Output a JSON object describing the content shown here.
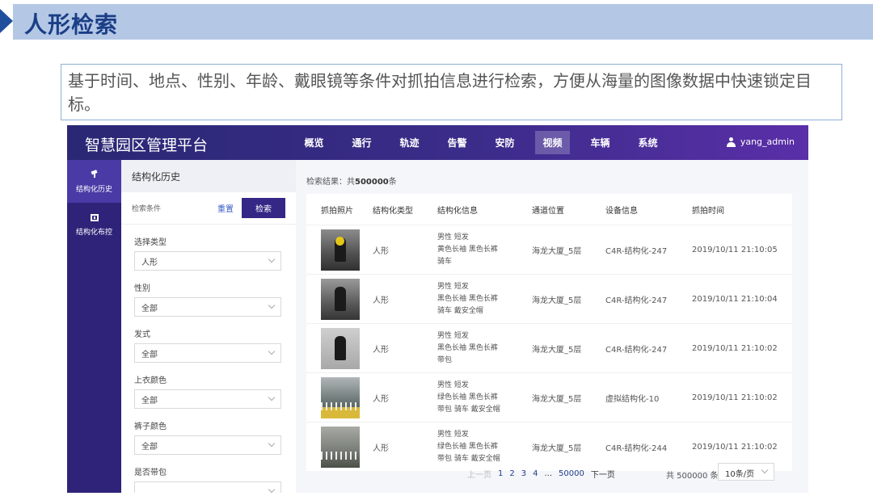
{
  "slide": {
    "title": "人形检索",
    "description": "基于时间、地点、性别、年龄、戴眼镜等条件对抓拍信息进行检索，方便从海量的图像数据中快速锁定目标。"
  },
  "app": {
    "title": "智慧园区管理平台",
    "nav": [
      "概览",
      "通行",
      "轨迹",
      "告警",
      "安防",
      "视频",
      "车辆",
      "系统"
    ],
    "active_nav": "视频",
    "user": "yang_admin"
  },
  "sidebar": {
    "items": [
      {
        "label": "结构化历史",
        "icon": "camera-icon"
      },
      {
        "label": "结构化布控",
        "icon": "calendar-icon"
      }
    ]
  },
  "filter": {
    "title": "结构化历史",
    "conditions_label": "检索条件",
    "reset": "重置",
    "search": "检索",
    "fields": [
      {
        "label": "选择类型",
        "value": "人形"
      },
      {
        "label": "性别",
        "value": "全部"
      },
      {
        "label": "发式",
        "value": "全部"
      },
      {
        "label": "上衣颜色",
        "value": "全部"
      },
      {
        "label": "裤子颜色",
        "value": "全部"
      },
      {
        "label": "是否带包",
        "value": ""
      }
    ]
  },
  "results": {
    "count_prefix": "检索结果：共",
    "count": "500000",
    "count_suffix": "条",
    "columns": [
      "抓拍照片",
      "结构化类型",
      "结构化信息",
      "通道位置",
      "设备信息",
      "抓拍时间"
    ],
    "rows": [
      {
        "type": "人形",
        "info": [
          "男性 短发",
          "黄色长袖 黑色长裤",
          "骑车"
        ],
        "location": "海龙大厦_5层",
        "device": "C4R-结构化-247",
        "time": "2019/10/11 21:10:05"
      },
      {
        "type": "人形",
        "info": [
          "男性 短发",
          "黑色长袖 黑色长裤",
          "骑车 戴安全帽"
        ],
        "location": "海龙大厦_5层",
        "device": "C4R-结构化-247",
        "time": "2019/10/11 21:10:04"
      },
      {
        "type": "人形",
        "info": [
          "男性 短发",
          "黑色长袖 黑色长裤",
          "带包"
        ],
        "location": "海龙大厦_5层",
        "device": "C4R-结构化-247",
        "time": "2019/10/11 21:10:02"
      },
      {
        "type": "人形",
        "info": [
          "男性 短发",
          "绿色长袖 黑色长裤",
          "带包 骑车 戴安全帽"
        ],
        "location": "海龙大厦_5层",
        "device": "虚拟结构化-10",
        "time": "2019/10/11 21:10:02"
      },
      {
        "type": "人形",
        "info": [
          "男性 短发",
          "绿色长袖 黑色长裤",
          "带包 骑车 戴安全帽"
        ],
        "location": "海龙大厦_5层",
        "device": "C4R-结构化-244",
        "time": "2019/10/11 21:10:02"
      }
    ]
  },
  "pagination": {
    "prev": "上一页",
    "pages": [
      "1",
      "2",
      "3",
      "4"
    ],
    "ellipsis": "...",
    "last": "50000",
    "next": "下一页",
    "total": "共 500000 条",
    "page_size": "10条/页"
  }
}
